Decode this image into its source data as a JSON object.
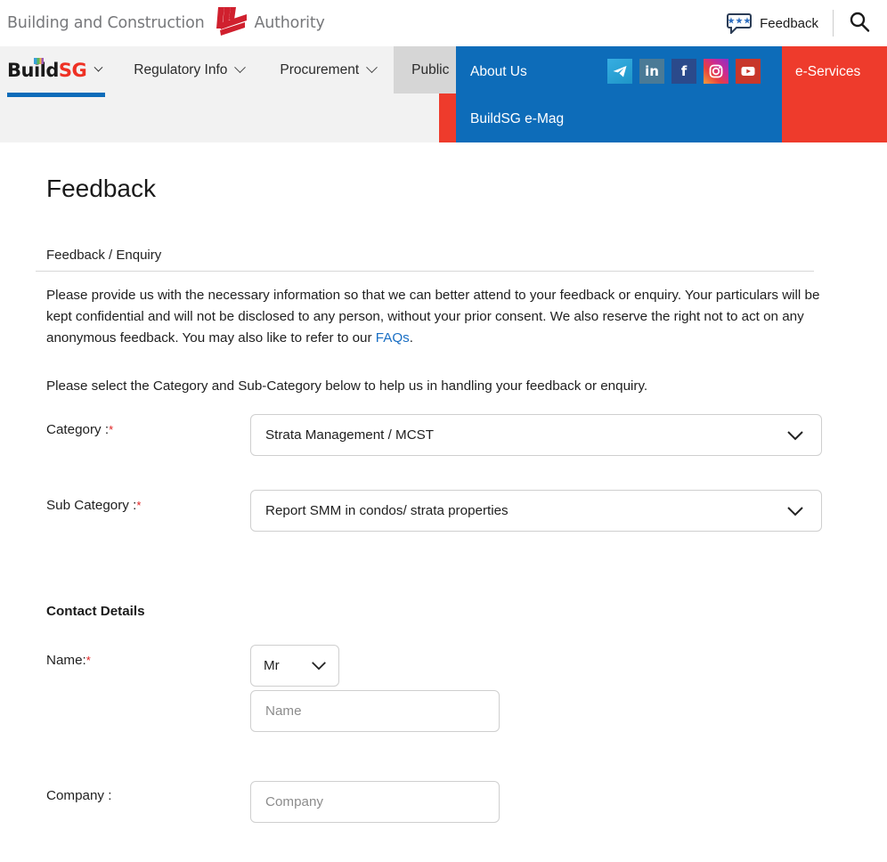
{
  "header": {
    "org_name_left": "Building and Construction",
    "org_name_right": "Authority",
    "logo_icon": "bca-logo-icon",
    "feedback_label": "Feedback",
    "feedback_icon": "speech-bubble-icon",
    "search_icon": "search-icon"
  },
  "nav": {
    "logo": {
      "build": "Build",
      "sg": "SG",
      "caret_icon": "chevron-down-icon"
    },
    "items": [
      {
        "label": "Regulatory Info",
        "has_caret": true,
        "active": false
      },
      {
        "label": "Procurement",
        "has_caret": true,
        "active": false
      },
      {
        "label": "Public",
        "has_caret": true,
        "active": true
      }
    ],
    "mega": {
      "items": [
        "About Us",
        "BuildSG e-Mag"
      ],
      "socials": [
        {
          "name": "telegram-icon",
          "glyph": "➤"
        },
        {
          "name": "linkedin-icon",
          "glyph": "in"
        },
        {
          "name": "facebook-icon",
          "glyph": "f"
        },
        {
          "name": "instagram-icon",
          "glyph": "▢"
        },
        {
          "name": "youtube-icon",
          "glyph": "▶"
        }
      ]
    },
    "eservices_label": "e-Services"
  },
  "page": {
    "title": "Feedback",
    "section_tab": "Feedback / Enquiry",
    "paragraph_1a": "Please provide us with the necessary information so that we can better attend to your feedback or enquiry. Your particulars will be kept confidential and will not be disclosed to any person, without your prior consent. We also reserve the right not to act on any anonymous feedback. You may also like to refer to our ",
    "faq_link": "FAQs",
    "paragraph_1b": ".",
    "paragraph_2": "Please select the Category and Sub-Category below to help us in handling your feedback or enquiry."
  },
  "form": {
    "category": {
      "label": "Category :",
      "required_mark": "*",
      "value": "Strata Management / MCST",
      "caret_icon": "chevron-down-icon"
    },
    "sub_category": {
      "label": "Sub Category :",
      "required_mark": "*",
      "value": "Report SMM in condos/ strata properties",
      "caret_icon": "chevron-down-icon"
    },
    "contact_heading": "Contact Details",
    "name": {
      "label": "Name:",
      "required_mark": "*",
      "salutation_value": "Mr",
      "salutation_caret_icon": "chevron-down-icon",
      "name_placeholder": "Name",
      "name_value": ""
    },
    "company": {
      "label": "Company :",
      "placeholder": "Company",
      "value": ""
    }
  },
  "colors": {
    "bca_red": "#ee3124",
    "nav_blue": "#0d6cb9",
    "eservices_red": "#ee3b2c",
    "link_blue": "#1a6fc4",
    "required_red": "#e02020"
  }
}
